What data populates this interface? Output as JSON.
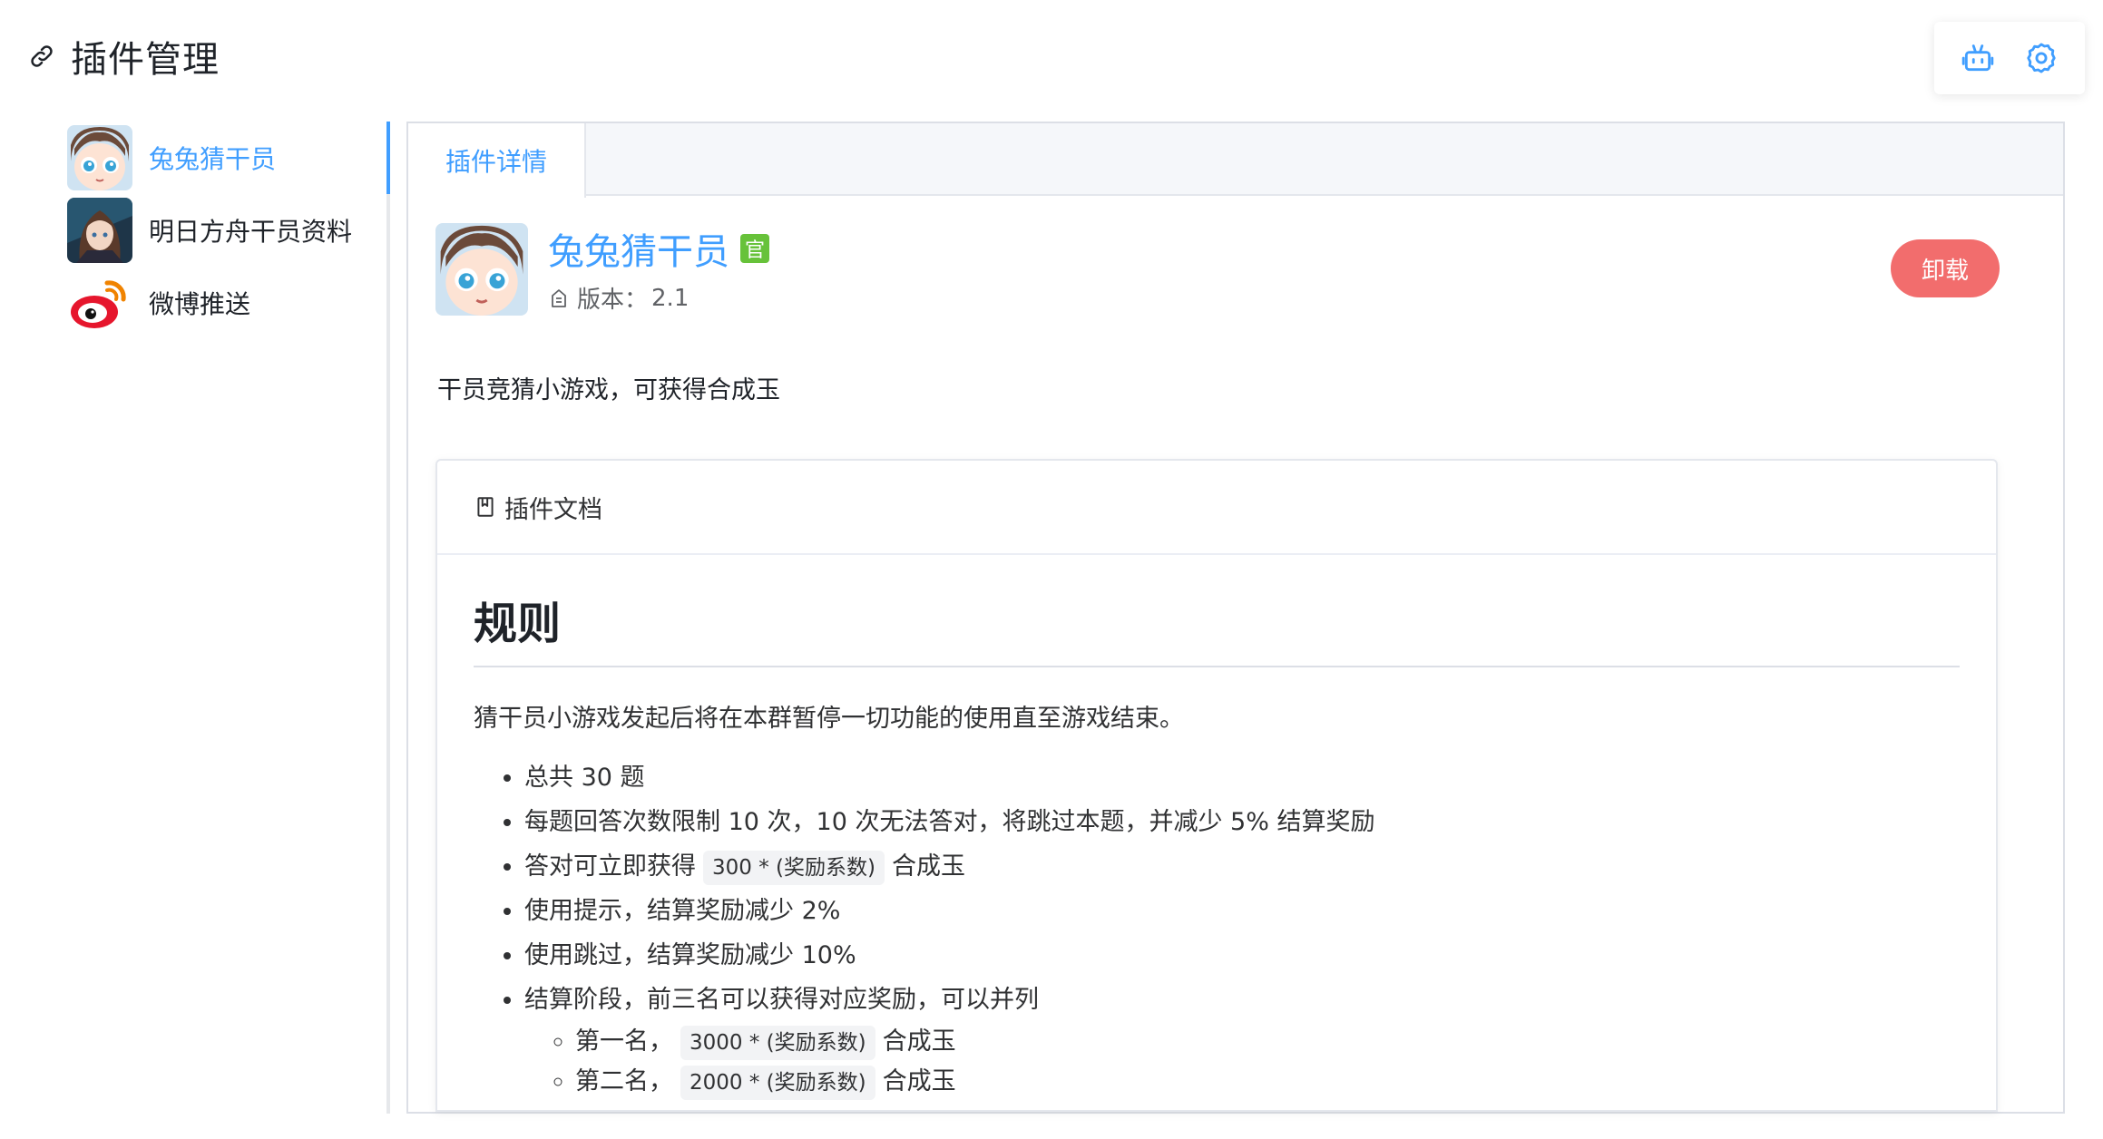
{
  "header": {
    "title": "插件管理"
  },
  "toolbar": {
    "icons": [
      "robot-icon",
      "gear-icon"
    ]
  },
  "sidebar": {
    "items": [
      {
        "label": "兔兔猜干员",
        "active": true
      },
      {
        "label": "明日方舟干员资料",
        "active": false
      },
      {
        "label": "微博推送",
        "active": false
      }
    ]
  },
  "tabs": [
    {
      "label": "插件详情"
    }
  ],
  "plugin": {
    "name": "兔兔猜干员",
    "official_badge": "官",
    "version_label": "版本：",
    "version": "2.1",
    "uninstall_label": "卸载",
    "description": "干员竞猜小游戏，可获得合成玉"
  },
  "doc": {
    "header": "插件文档",
    "h1": "规则",
    "intro": "猜干员小游戏发起后将在本群暂停一切功能的使用直至游戏结束。",
    "list": [
      {
        "text": "总共 30 题"
      },
      {
        "text": "每题回答次数限制 10 次，10 次无法答对，将跳过本题，并减少 5% 结算奖励"
      },
      {
        "before": "答对可立即获得",
        "code": "300 * (奖励系数)",
        "after": "合成玉"
      },
      {
        "text": "使用提示，结算奖励减少 2%"
      },
      {
        "text": "使用跳过，结算奖励减少 10%"
      },
      {
        "text": "结算阶段，前三名可以获得对应奖励，可以并列"
      }
    ],
    "sublist": [
      {
        "before": "第一名，",
        "code": "3000 * (奖励系数)",
        "after": "合成玉"
      },
      {
        "before": "第二名，",
        "code": "2000 * (奖励系数)",
        "after": "合成玉"
      }
    ]
  },
  "colors": {
    "accent": "#409eff",
    "danger": "#f26d6d",
    "official": "#67c23a"
  }
}
